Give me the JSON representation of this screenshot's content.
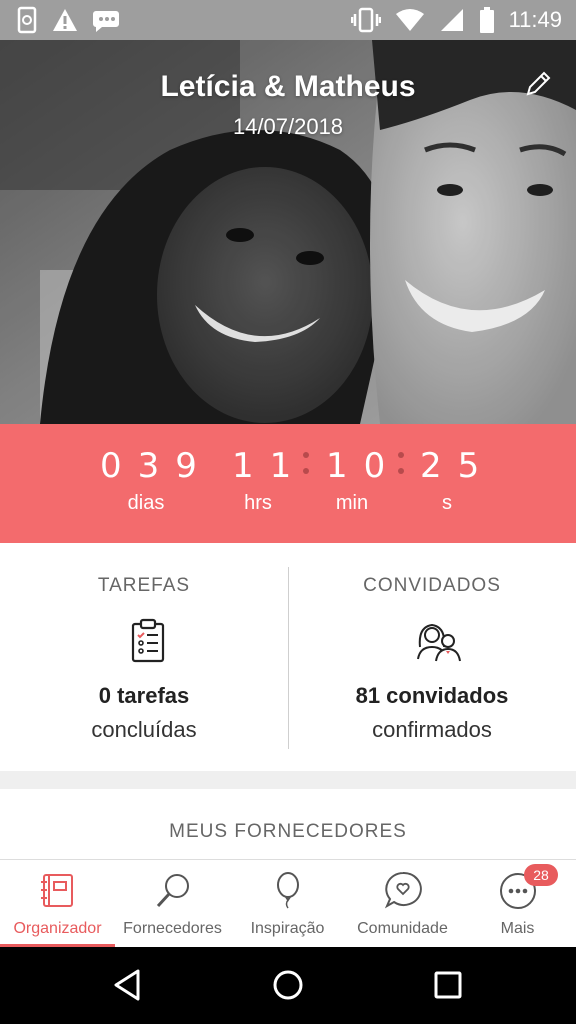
{
  "status_bar": {
    "time": "11:49",
    "icons": [
      "screenshot-icon",
      "warning-icon",
      "message-icon",
      "vibrate-icon",
      "wifi-icon",
      "signal-icon",
      "battery-icon"
    ]
  },
  "hero": {
    "names": "Letícia & Matheus",
    "date": "14/07/2018",
    "edit_icon": "pencil-icon"
  },
  "countdown": {
    "days": "039",
    "hours": "11",
    "minutes": "10",
    "seconds": "25",
    "days_label": "dias",
    "hours_label": "hrs",
    "minutes_label": "min",
    "seconds_label": "s",
    "color": "#f36b6d"
  },
  "stats": {
    "tasks": {
      "title": "TAREFAS",
      "count": "0 tarefas",
      "subtitle": "concluídas",
      "icon": "checklist-icon"
    },
    "guests": {
      "title": "CONVIDADOS",
      "count": "81 convidados",
      "subtitle": "confirmados",
      "icon": "guests-icon"
    }
  },
  "suppliers": {
    "title": "MEUS FORNECEDORES"
  },
  "tabs": [
    {
      "label": "Organizador",
      "icon": "planner-icon",
      "active": true
    },
    {
      "label": "Fornecedores",
      "icon": "magnifier-icon",
      "active": false
    },
    {
      "label": "Inspiração",
      "icon": "balloon-icon",
      "active": false
    },
    {
      "label": "Comunidade",
      "icon": "chat-heart-icon",
      "active": false
    },
    {
      "label": "Mais",
      "icon": "more-icon",
      "active": false,
      "badge": "28"
    }
  ],
  "accent": "#e85b5d"
}
